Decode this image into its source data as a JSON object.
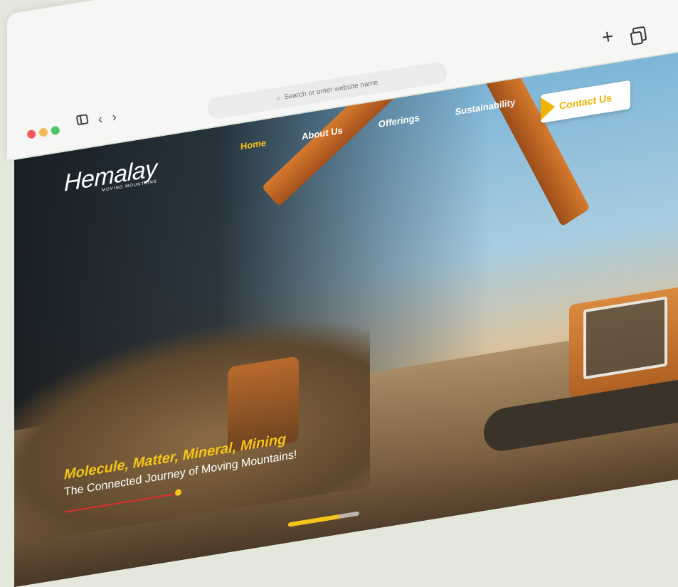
{
  "browser": {
    "address_placeholder": "Search or enter website name",
    "new_tab_icon": "plus-icon",
    "tabs_icon": "copy-icon",
    "sidebar_icon": "sidebar-icon",
    "back": "‹",
    "forward": "›"
  },
  "site": {
    "logo": "Hemalay",
    "logo_sub": "MOVING MOUNTAINS",
    "nav": [
      {
        "label": "Home",
        "active": true
      },
      {
        "label": "About Us",
        "active": false
      },
      {
        "label": "Offerings",
        "active": false
      },
      {
        "label": "Sustainability",
        "active": false
      }
    ],
    "contact_label": "Contact Us",
    "hero": {
      "tagline": "Molecule, Matter, Mineral, Mining",
      "subline": "The Connected Journey of Moving Mountains!",
      "slide_progress": 0.72
    }
  },
  "colors": {
    "accent": "#f5c518",
    "accent_line": "#e0302a",
    "background": "#e4e8dc"
  }
}
